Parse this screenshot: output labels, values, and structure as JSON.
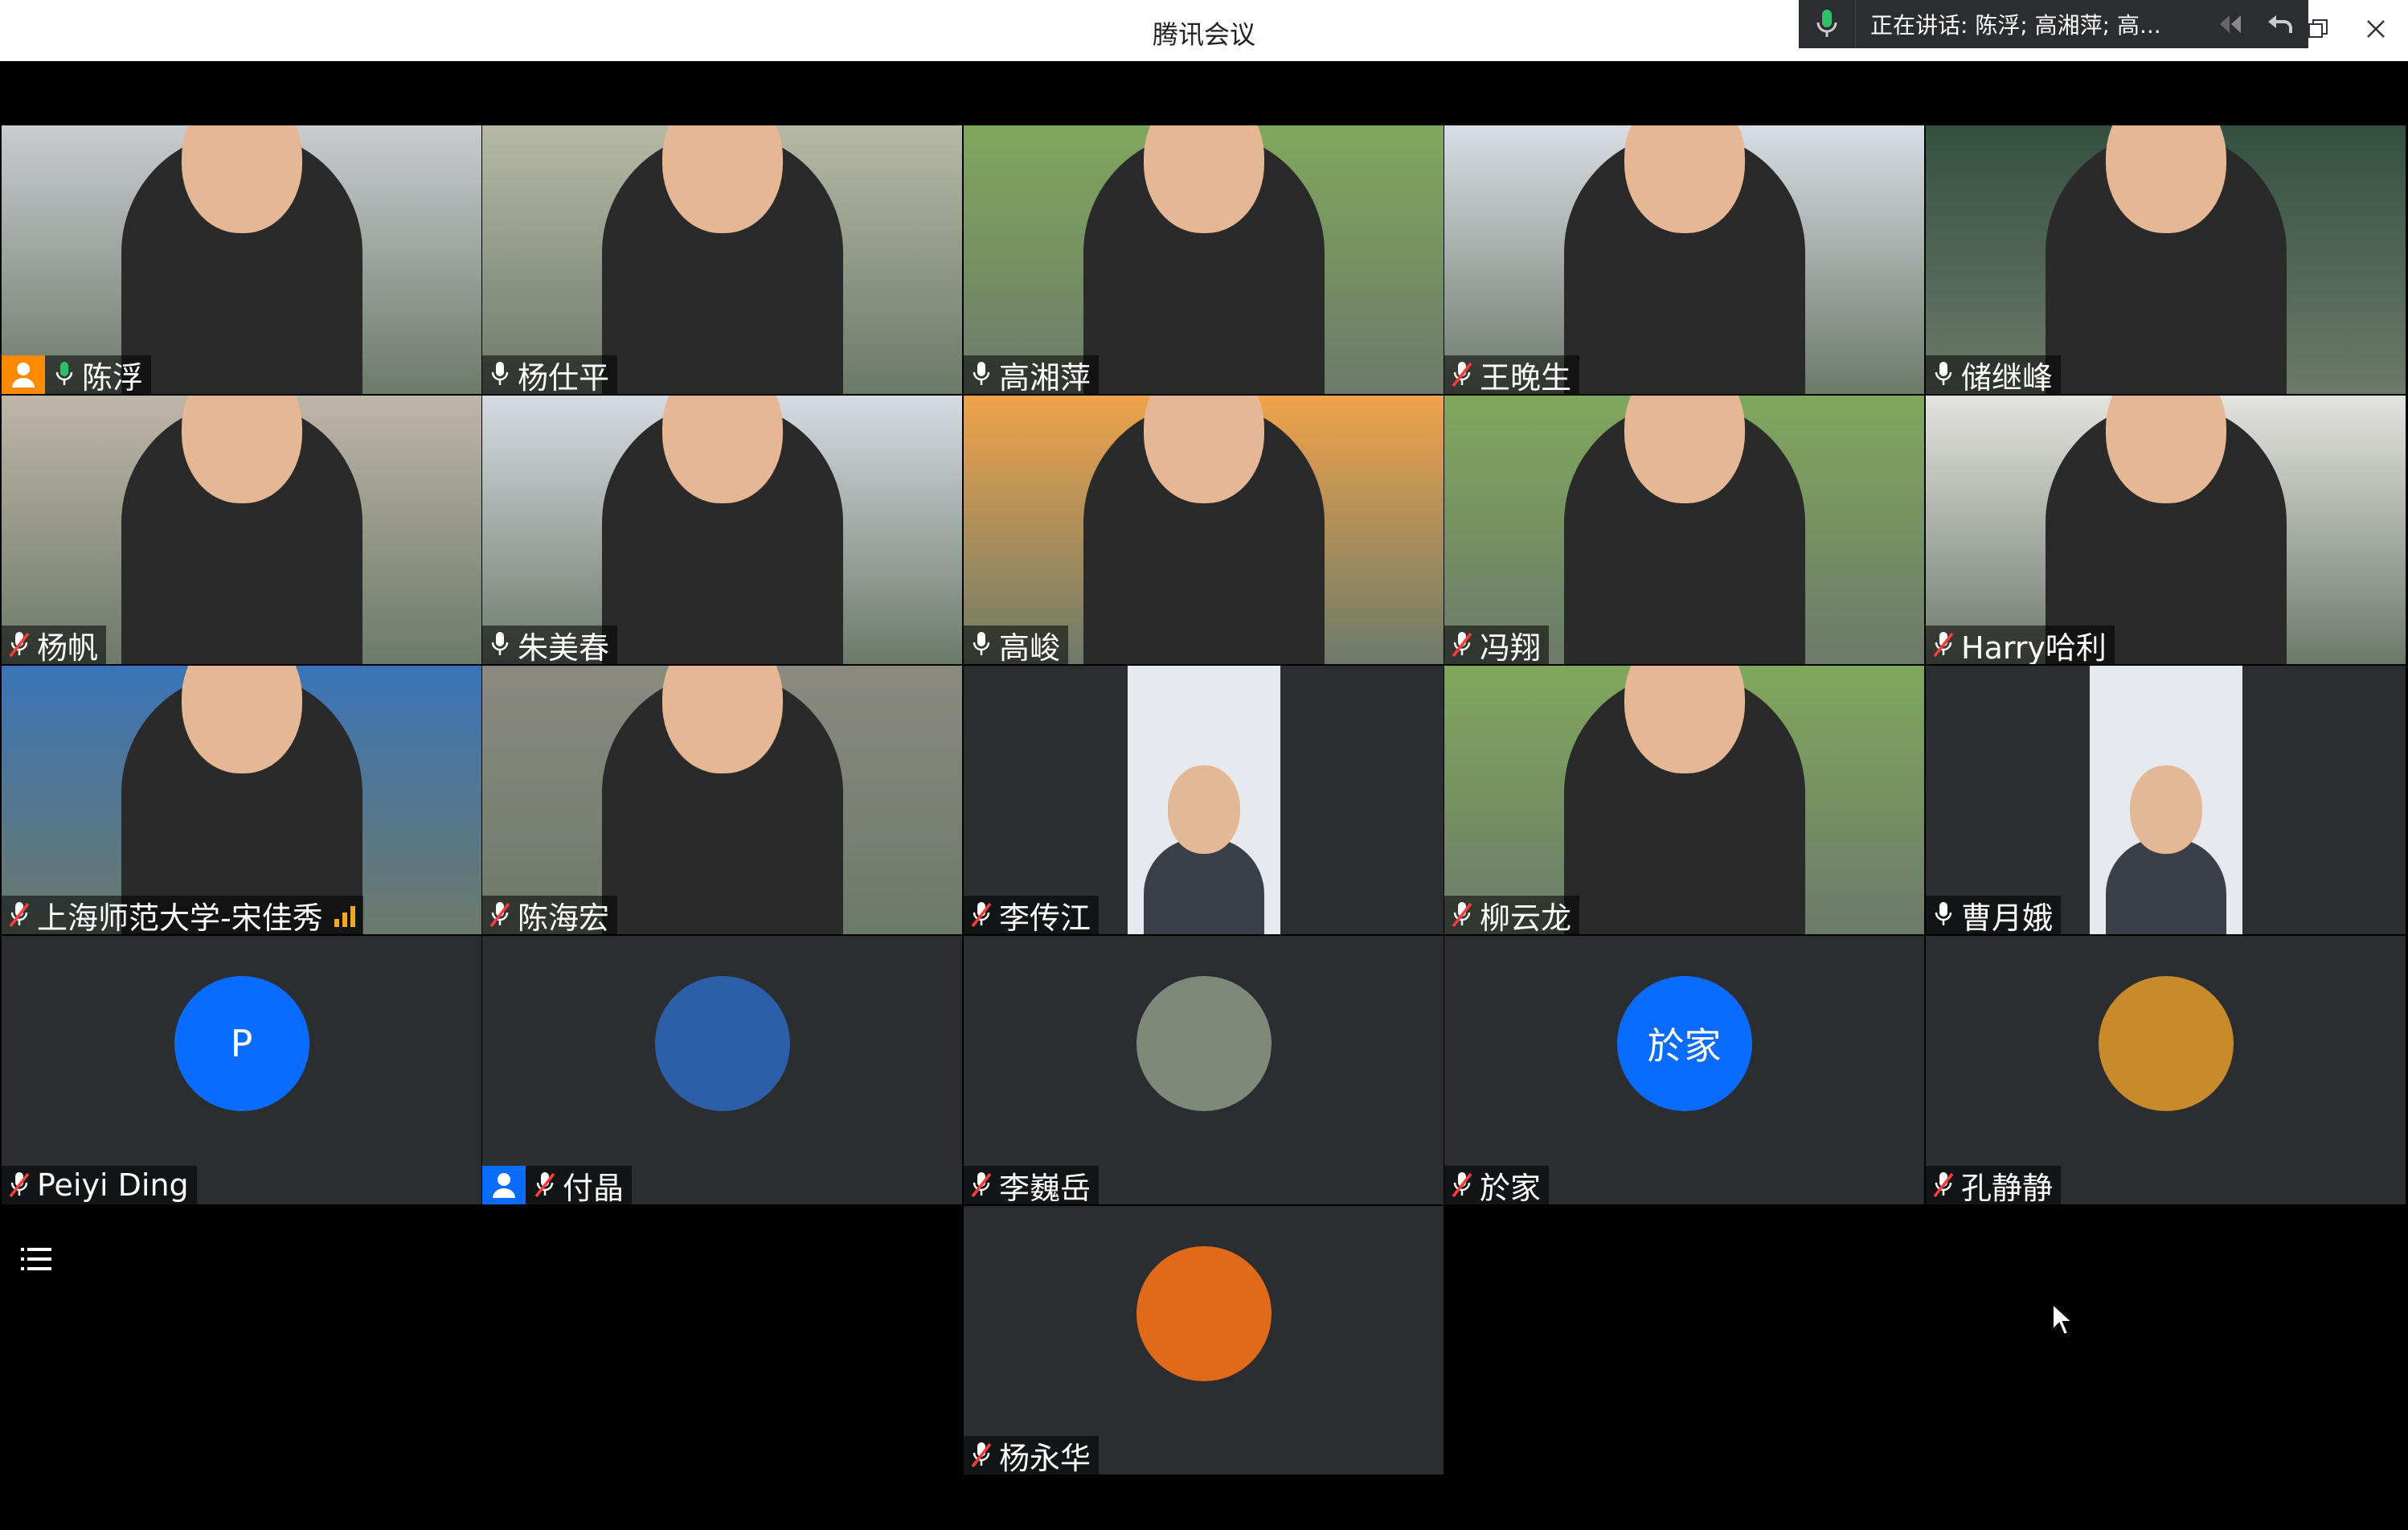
{
  "window": {
    "title": "腾讯会议"
  },
  "speaking_bar": {
    "text": "正在讲话: 陈浮; 高湘萍; 高..."
  },
  "participants": [
    {
      "name": "陈浮",
      "mic": "on",
      "host": true,
      "view": "video",
      "bg": "#c9ccd0"
    },
    {
      "name": "杨仕平",
      "mic": "on",
      "view": "video",
      "bg": "#b7b9a6"
    },
    {
      "name": "高湘萍",
      "mic": "on",
      "view": "video",
      "bg": "#7fa85c"
    },
    {
      "name": "王晚生",
      "mic": "off",
      "view": "video",
      "bg": "#d8dde4"
    },
    {
      "name": "储继峰",
      "mic": "on",
      "view": "video",
      "bg": "#33513f"
    },
    {
      "name": "杨帆",
      "mic": "off",
      "view": "video",
      "bg": "#bfb6a8"
    },
    {
      "name": "朱美春",
      "mic": "on",
      "view": "video",
      "bg": "#d6dbe2"
    },
    {
      "name": "高峻",
      "mic": "on",
      "view": "video",
      "bg": "#f0a34a"
    },
    {
      "name": "冯翔",
      "mic": "off",
      "view": "video",
      "bg": "#7fa85c"
    },
    {
      "name": "Harry哈利",
      "mic": "off",
      "view": "video",
      "bg": "#e4e3df"
    },
    {
      "name": "上海师范大学-宋佳秀",
      "mic": "off",
      "view": "video",
      "bg": "#3a74b8",
      "signal": true
    },
    {
      "name": "陈海宏",
      "mic": "off",
      "view": "video",
      "bg": "#8b8a80"
    },
    {
      "name": "李传江",
      "mic": "off",
      "view": "narrow",
      "bg": "#e6eaef"
    },
    {
      "name": "柳云龙",
      "mic": "off",
      "view": "video",
      "bg": "#7fa85c"
    },
    {
      "name": "曹月娥",
      "mic": "on",
      "view": "narrow",
      "bg": "#e6eaef"
    },
    {
      "name": "Peiyi Ding",
      "mic": "off",
      "view": "avatar",
      "avatar_text": "P",
      "avatar_color": "#0a6cff"
    },
    {
      "name": "付晶",
      "mic": "off",
      "view": "avatar",
      "host": true,
      "avatar_text": "",
      "avatar_color": "#2b5fa8"
    },
    {
      "name": "李巍岳",
      "mic": "off",
      "view": "avatar",
      "avatar_text": "",
      "avatar_color": "#7d8a7a"
    },
    {
      "name": "於家",
      "mic": "off",
      "view": "avatar",
      "avatar_text": "於家",
      "avatar_color": "#0a6cff"
    },
    {
      "name": "孔静静",
      "mic": "off",
      "view": "avatar",
      "avatar_text": "",
      "avatar_color": "#c88a2a"
    },
    {
      "name": "杨永华",
      "mic": "off",
      "view": "avatar",
      "avatar_text": "",
      "avatar_color": "#e06a1a"
    }
  ]
}
